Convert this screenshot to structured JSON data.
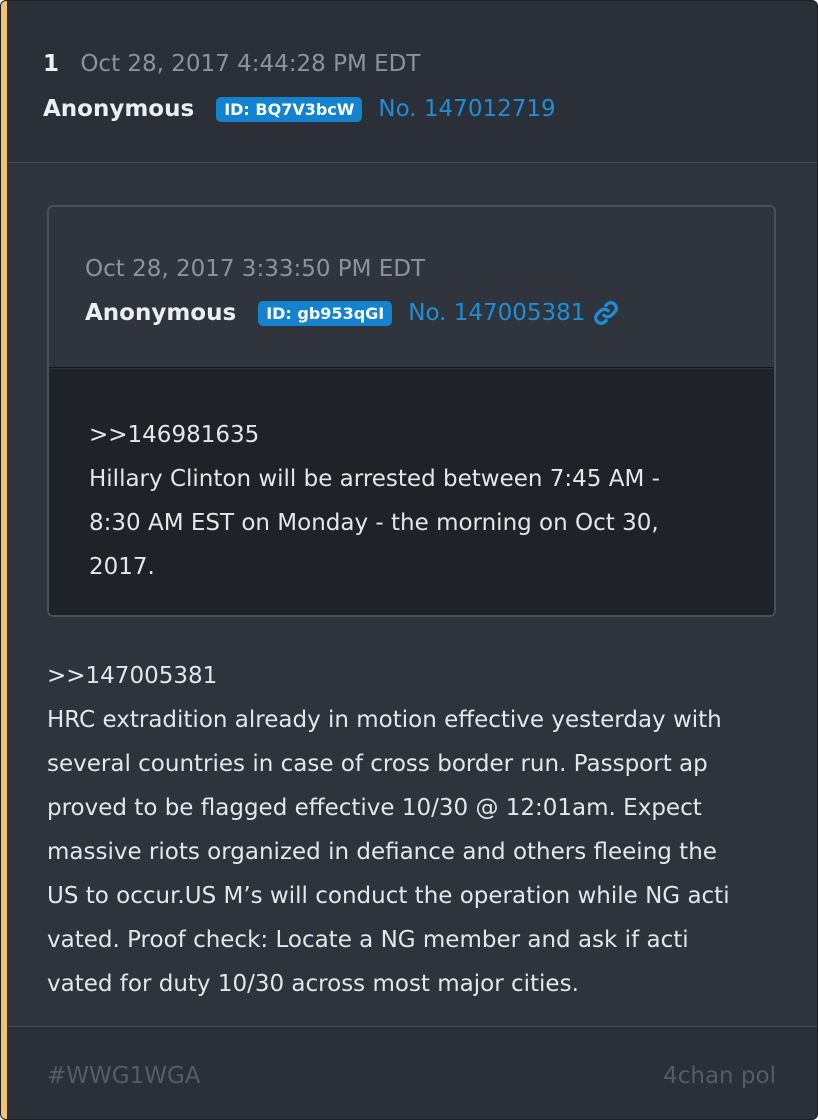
{
  "post": {
    "number": "1",
    "timestamp": "Oct 28, 2017 4:44:28 PM EDT",
    "author": "Anonymous",
    "id_badge": "ID: BQ7V3bcW",
    "post_link": "No. 147012719"
  },
  "quote": {
    "timestamp": "Oct 28, 2017 3:33:50 PM EDT",
    "author": "Anonymous",
    "id_badge": "ID: gb953qGI",
    "post_link": "No. 147005381",
    "icon": "link-icon",
    "lines": [
      ">>146981635",
      "Hillary Clinton will be arrested between 7:45 AM -",
      "8:30 AM EST on Monday - the morning on Oct 30,",
      "2017."
    ]
  },
  "body": {
    "lines": [
      ">>147005381",
      "HRC extradition already in motion effective yesterday with",
      "several countries in case of cross border run. Passport ap",
      "proved to be flagged effective 10/30 @ 12:01am. Expect",
      "massive riots organized in defiance and others fleeing the",
      "US to occur.US M’s will conduct the operation while NG acti",
      "vated. Proof check: Locate a NG member and ask if acti",
      "vated for duty 10/30 across most major cities."
    ]
  },
  "footer": {
    "hashtag": "#WWG1WGA",
    "source": "4chan pol"
  },
  "colors": {
    "accent_bar": "#f2c275",
    "id_badge": "#1483cf",
    "link": "#1d8fd8",
    "card_background": "#2e333c",
    "quote_body_background": "#1f2227"
  }
}
